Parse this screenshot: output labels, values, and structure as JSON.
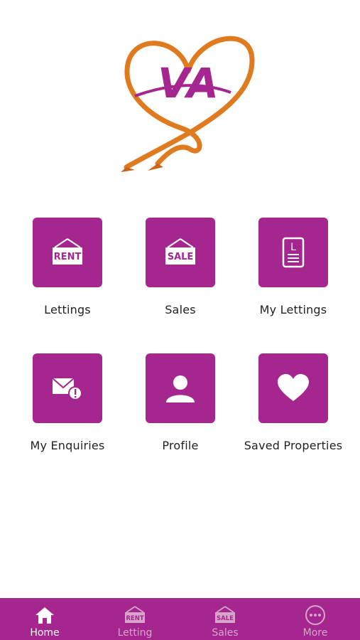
{
  "brand": {
    "logo_text": "VA",
    "accent_color": "#a5268f",
    "ribbon_color": "#e07a1f"
  },
  "tiles": [
    {
      "label": "Lettings",
      "icon": "rent-sign-icon",
      "sign_text": "RENT"
    },
    {
      "label": "Sales",
      "icon": "sale-sign-icon",
      "sign_text": "SALE"
    },
    {
      "label": "My Lettings",
      "icon": "document-icon",
      "doc_letter": "L"
    },
    {
      "label": "My Enquiries",
      "icon": "mail-alert-icon"
    },
    {
      "label": "Profile",
      "icon": "user-icon"
    },
    {
      "label": "Saved Properties",
      "icon": "heart-icon"
    }
  ],
  "navbar": {
    "items": [
      {
        "label": "Home",
        "icon": "home-icon",
        "active": true
      },
      {
        "label": "Letting",
        "icon": "rent-sign-icon",
        "sign_text": "RENT",
        "active": false
      },
      {
        "label": "Sales",
        "icon": "sale-sign-icon",
        "sign_text": "SALE",
        "active": false
      },
      {
        "label": "More",
        "icon": "more-icon",
        "active": false
      }
    ]
  }
}
